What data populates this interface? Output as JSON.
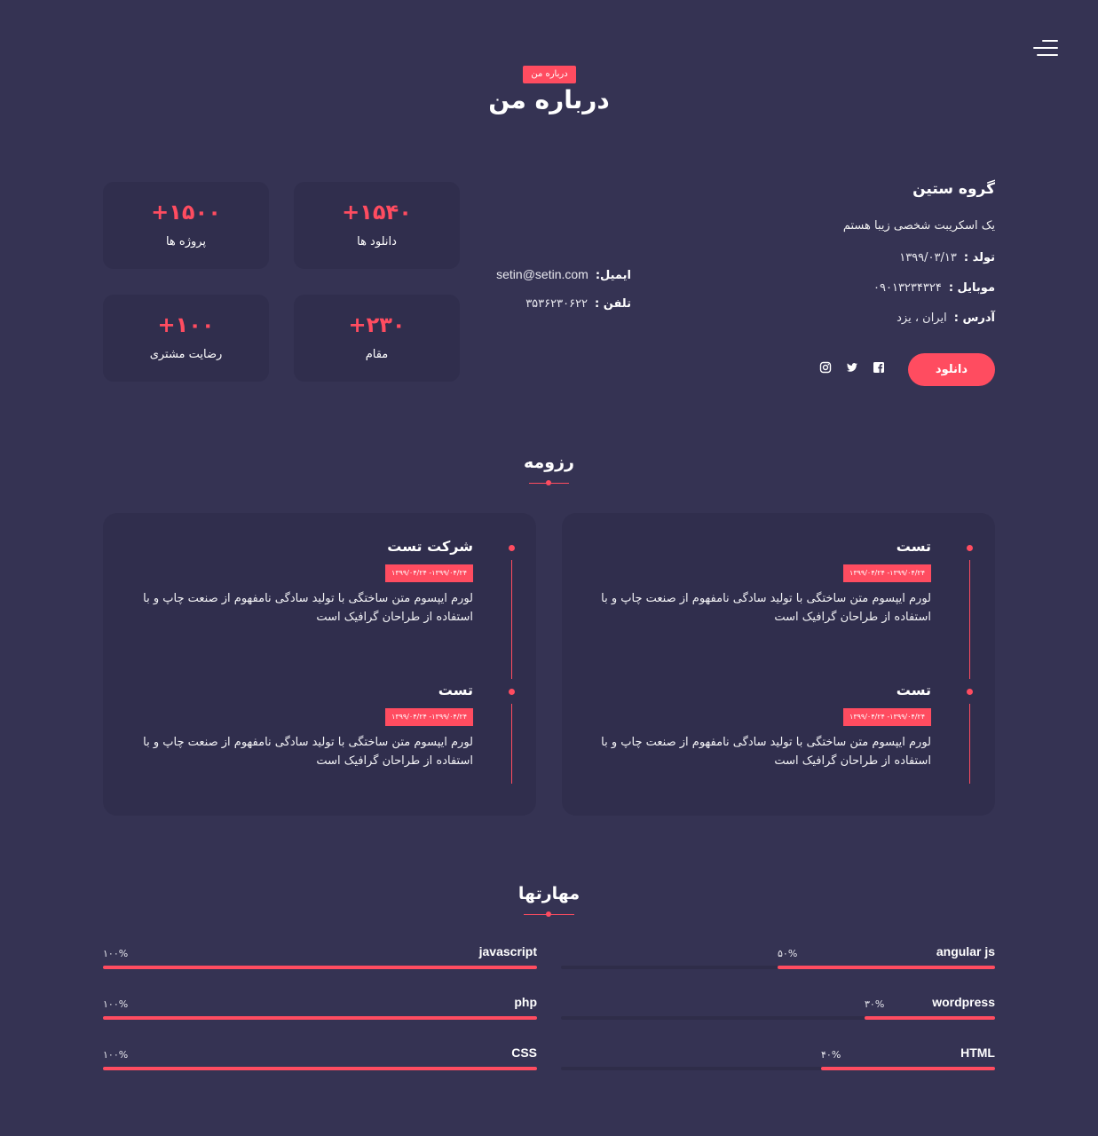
{
  "header": {
    "badge": "درباره من",
    "title": "درباره من"
  },
  "about": {
    "name": "گروه ستین",
    "bio": "یک اسکریبت شخصی زیبا هستم",
    "birth_label": "تولد :",
    "birth_value": "۱۳۹۹/۰۳/۱۳",
    "mobile_label": "موبایل :",
    "mobile_value": "۰۹۰۱۳۲۳۴۳۲۴",
    "address_label": "آدرس :",
    "address_value": "ایران ، یزد",
    "email_label": "ایمیل:",
    "email_value": "setin@setin.com",
    "phone_label": "تلفن :",
    "phone_value": "۳۵۳۶۲۳۰۶۲۲",
    "download_label": "دانلود",
    "social": [
      "facebook-icon",
      "twitter-icon",
      "instagram-icon"
    ]
  },
  "stats": [
    {
      "number": "+۱۵۴۰",
      "label": "دانلود ها"
    },
    {
      "number": "+۱۵۰۰",
      "label": "پروژه ها"
    },
    {
      "number": "+۲۳۰",
      "label": "مقام"
    },
    {
      "number": "+۱۰۰",
      "label": "رضایت مشتری"
    }
  ],
  "resume": {
    "title": "رزومه",
    "right_column": [
      {
        "title": "تست",
        "date": "۱۳۹۹/۰۴/۲۴- ۱۳۹۹/۰۴/۲۴",
        "text": "لورم ایپسوم متن ساختگی با تولید سادگی نامفهوم از صنعت چاپ و با استفاده از طراحان گرافیک است"
      },
      {
        "title": "تست",
        "date": "۱۳۹۹/۰۴/۲۴- ۱۳۹۹/۰۴/۲۴",
        "text": "لورم ایپسوم متن ساختگی با تولید سادگی نامفهوم از صنعت چاپ و با استفاده از طراحان گرافیک است"
      }
    ],
    "left_column": [
      {
        "title": "شرکت تست",
        "date": "۱۳۹۹/۰۴/۲۴- ۱۳۹۹/۰۴/۲۴",
        "text": "لورم ایپسوم متن ساختگی با تولید سادگی نامفهوم از صنعت چاپ و با استفاده از طراحان گرافیک است"
      },
      {
        "title": "تست",
        "date": "۱۳۹۹/۰۴/۲۴- ۱۳۹۹/۰۴/۲۴",
        "text": "لورم ایپسوم متن ساختگی با تولید سادگی نامفهوم از صنعت چاپ و با استفاده از طراحان گرافیک است"
      }
    ]
  },
  "skills": {
    "title": "مهارتها",
    "right_column": [
      {
        "name": "angular js",
        "percent_label": "۵۰%",
        "level": 0.5
      },
      {
        "name": "wordpress",
        "percent_label": "۳۰%",
        "level": 0.3
      },
      {
        "name": "HTML",
        "percent_label": "۴۰%",
        "level": 0.4
      }
    ],
    "left_column": [
      {
        "name": "javascript",
        "percent_label": "۱۰۰%",
        "level": 1.0
      },
      {
        "name": "php",
        "percent_label": "۱۰۰%",
        "level": 1.0
      },
      {
        "name": "CSS",
        "percent_label": "۱۰۰%",
        "level": 1.0
      }
    ]
  },
  "colors": {
    "background": "#353353",
    "card": "#302e4d",
    "accent": "#ff4c60"
  }
}
